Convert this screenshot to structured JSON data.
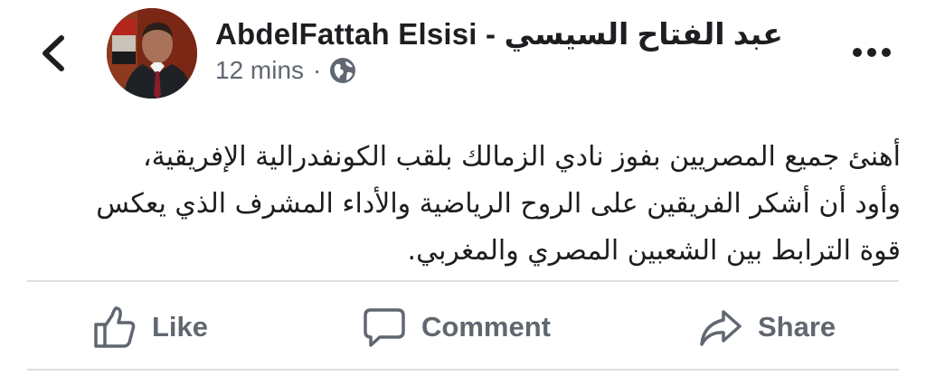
{
  "header": {
    "author": "AbdelFattah Elsisi - عبد الفتاح السيسي",
    "time": "12 mins",
    "separator": "·",
    "privacy_icon": "globe-icon",
    "back_icon": "chevron-left-icon",
    "more_icon": "more-horizontal-icon"
  },
  "post": {
    "text": "أهنئ جميع المصريين بفوز  نادي الزمالك بلقب الكونفدرالية الإفريقية،\nوأود أن أشكر الفريقين على الروح الرياضية والأداء المشرف الذي يعكس\nقوة الترابط بين الشعبين المصري والمغربي."
  },
  "actions": {
    "like": "Like",
    "comment": "Comment",
    "share": "Share"
  },
  "colors": {
    "text": "#1c1e21",
    "secondary": "#606770",
    "divider": "#dddfe2"
  }
}
